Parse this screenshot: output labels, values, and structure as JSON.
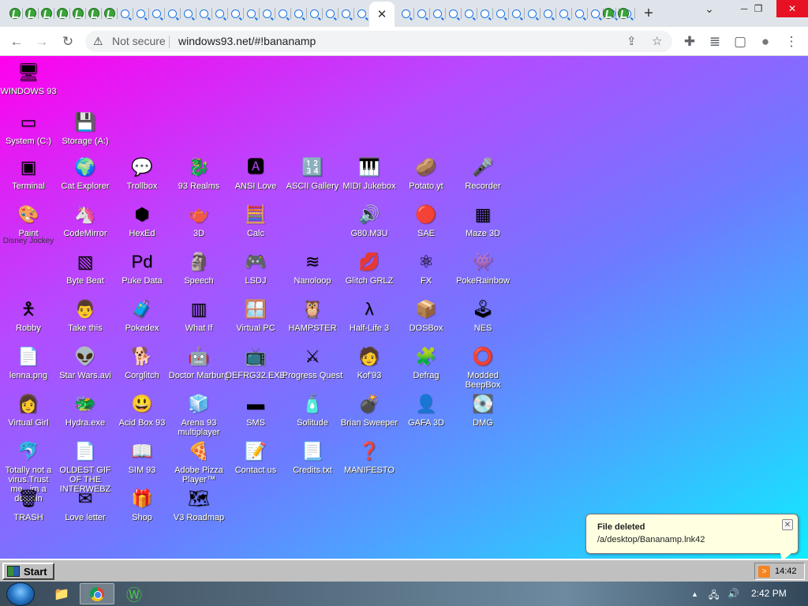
{
  "browser": {
    "active_tab_close": "✕",
    "new_tab": "+",
    "tab_menu": "⌄",
    "window_controls": {
      "minimize": "─",
      "restore": "❐",
      "close": "✕"
    },
    "nav": {
      "back": "←",
      "forward": "→",
      "reload": "↻"
    },
    "security_warning_icon": "⚠",
    "security_label": "Not secure",
    "url": "windows93.net/#!bananamp",
    "omnibox_icons": {
      "share": "⇪",
      "bookmark": "☆"
    },
    "toolbar_icons": {
      "extensions": "✚",
      "media": "≣",
      "sidepanel": "▢",
      "profile": "●",
      "menu": "⋮"
    }
  },
  "desktop": {
    "icons": [
      {
        "label": "WINDOWS 93",
        "glyph": "🖥"
      },
      {
        "label": "System (C:)",
        "glyph": "▭"
      },
      {
        "label": "Storage (A:)",
        "glyph": "💾"
      },
      {
        "label": "Terminal",
        "glyph": "▣"
      },
      {
        "label": "Cat Explorer",
        "glyph": "🌍"
      },
      {
        "label": "Trollbox",
        "glyph": "💬"
      },
      {
        "label": "93 Realms",
        "glyph": "🐉"
      },
      {
        "label": "ANSI Love",
        "glyph": "🅰"
      },
      {
        "label": "ASCII Gallery",
        "glyph": "🔢"
      },
      {
        "label": "MIDI Jukebox",
        "glyph": "🎹"
      },
      {
        "label": "Potato.yt",
        "glyph": "🥔"
      },
      {
        "label": "Recorder",
        "glyph": "🎤"
      },
      {
        "label": "Paint",
        "glyph": "🎨"
      },
      {
        "label": "Disney Jockey",
        "glyph": ""
      },
      {
        "label": "CodeMirror",
        "glyph": "🦄"
      },
      {
        "label": "HexEd",
        "glyph": "⬢"
      },
      {
        "label": "3D",
        "glyph": "🫖"
      },
      {
        "label": "Calc",
        "glyph": "🧮"
      },
      {
        "label": "G80.M3U",
        "glyph": "🔊"
      },
      {
        "label": "SAE",
        "glyph": "🔴"
      },
      {
        "label": "Maze 3D",
        "glyph": "▦"
      },
      {
        "label": "Byte Beat",
        "glyph": "▧"
      },
      {
        "label": "Puke Data",
        "glyph": "Pd"
      },
      {
        "label": "Speech",
        "glyph": "🗿"
      },
      {
        "label": "LSDJ",
        "glyph": "🎮"
      },
      {
        "label": "Nanoloop",
        "glyph": "≋"
      },
      {
        "label": "Glitch GRLZ",
        "glyph": "💋"
      },
      {
        "label": "FX",
        "glyph": "⚛"
      },
      {
        "label": "PokeRainbow",
        "glyph": "👾"
      },
      {
        "label": "Robby",
        "glyph": "🯅"
      },
      {
        "label": "Take this",
        "glyph": "👨"
      },
      {
        "label": "Pokedex",
        "glyph": "🧳"
      },
      {
        "label": "What If",
        "glyph": "▥"
      },
      {
        "label": "Virtual PC",
        "glyph": "🪟"
      },
      {
        "label": "HAMPSTER",
        "glyph": "🦉"
      },
      {
        "label": "Half-Life 3",
        "glyph": "λ"
      },
      {
        "label": "DOSBox",
        "glyph": "📦"
      },
      {
        "label": "NES",
        "glyph": "🕹"
      },
      {
        "label": "lenna.png",
        "glyph": "📄"
      },
      {
        "label": "Star Wars.avi",
        "glyph": "👽"
      },
      {
        "label": "Corglitch",
        "glyph": "🐕"
      },
      {
        "label": "Doctor Marburg",
        "glyph": "🤖"
      },
      {
        "label": "DEFRG32.EXE",
        "glyph": "📺"
      },
      {
        "label": "Progress Quest",
        "glyph": "⚔"
      },
      {
        "label": "Kof'93",
        "glyph": "🧑"
      },
      {
        "label": "Defrag",
        "glyph": "🧩"
      },
      {
        "label": "Modded BeepBox",
        "glyph": "⭕"
      },
      {
        "label": "Virtual Girl",
        "glyph": "👩"
      },
      {
        "label": "Hydra.exe",
        "glyph": "🐲"
      },
      {
        "label": "Acid Box 93",
        "glyph": "😃"
      },
      {
        "label": "Arena 93 multiplayer",
        "glyph": "🧊"
      },
      {
        "label": "SMS",
        "glyph": "▬"
      },
      {
        "label": "Solitude",
        "glyph": "🧴"
      },
      {
        "label": "Brian Sweeper",
        "glyph": "💣"
      },
      {
        "label": "GAFA 3D",
        "glyph": "👤"
      },
      {
        "label": "DMG",
        "glyph": "💽"
      },
      {
        "label": "Totally not a virus.Trust me...im a dolphin",
        "glyph": "🐬"
      },
      {
        "label": "OLDEST GIF OF THE INTERWEBZ",
        "glyph": "📄"
      },
      {
        "label": "SIM 93",
        "glyph": "📖"
      },
      {
        "label": "Adobe Pizza Player™",
        "glyph": "🍕"
      },
      {
        "label": "Contact us",
        "glyph": "📝"
      },
      {
        "label": "Credits.txt",
        "glyph": "📃"
      },
      {
        "label": "MANIFESTO",
        "glyph": "❓"
      },
      {
        "label": "TRASH",
        "glyph": "🗑"
      },
      {
        "label": "Love letter",
        "glyph": "✉"
      },
      {
        "label": "Shop",
        "glyph": "🎁"
      },
      {
        "label": "V3 Roadmap",
        "glyph": "🗺"
      }
    ]
  },
  "notification": {
    "title": "File deleted",
    "message": "/a/desktop/Bananamp.lnk42",
    "close": "✕"
  },
  "w93_taskbar": {
    "start_label": "Start",
    "clock": "14:42",
    "rss_icon": ">"
  },
  "os_taskbar": {
    "explorer_glyph": "📁",
    "w93_glyph": "Ⓦ",
    "tray": {
      "arrow": "▲",
      "network": "🖧",
      "volume": "🔊"
    },
    "clock": "2:42 PM"
  }
}
